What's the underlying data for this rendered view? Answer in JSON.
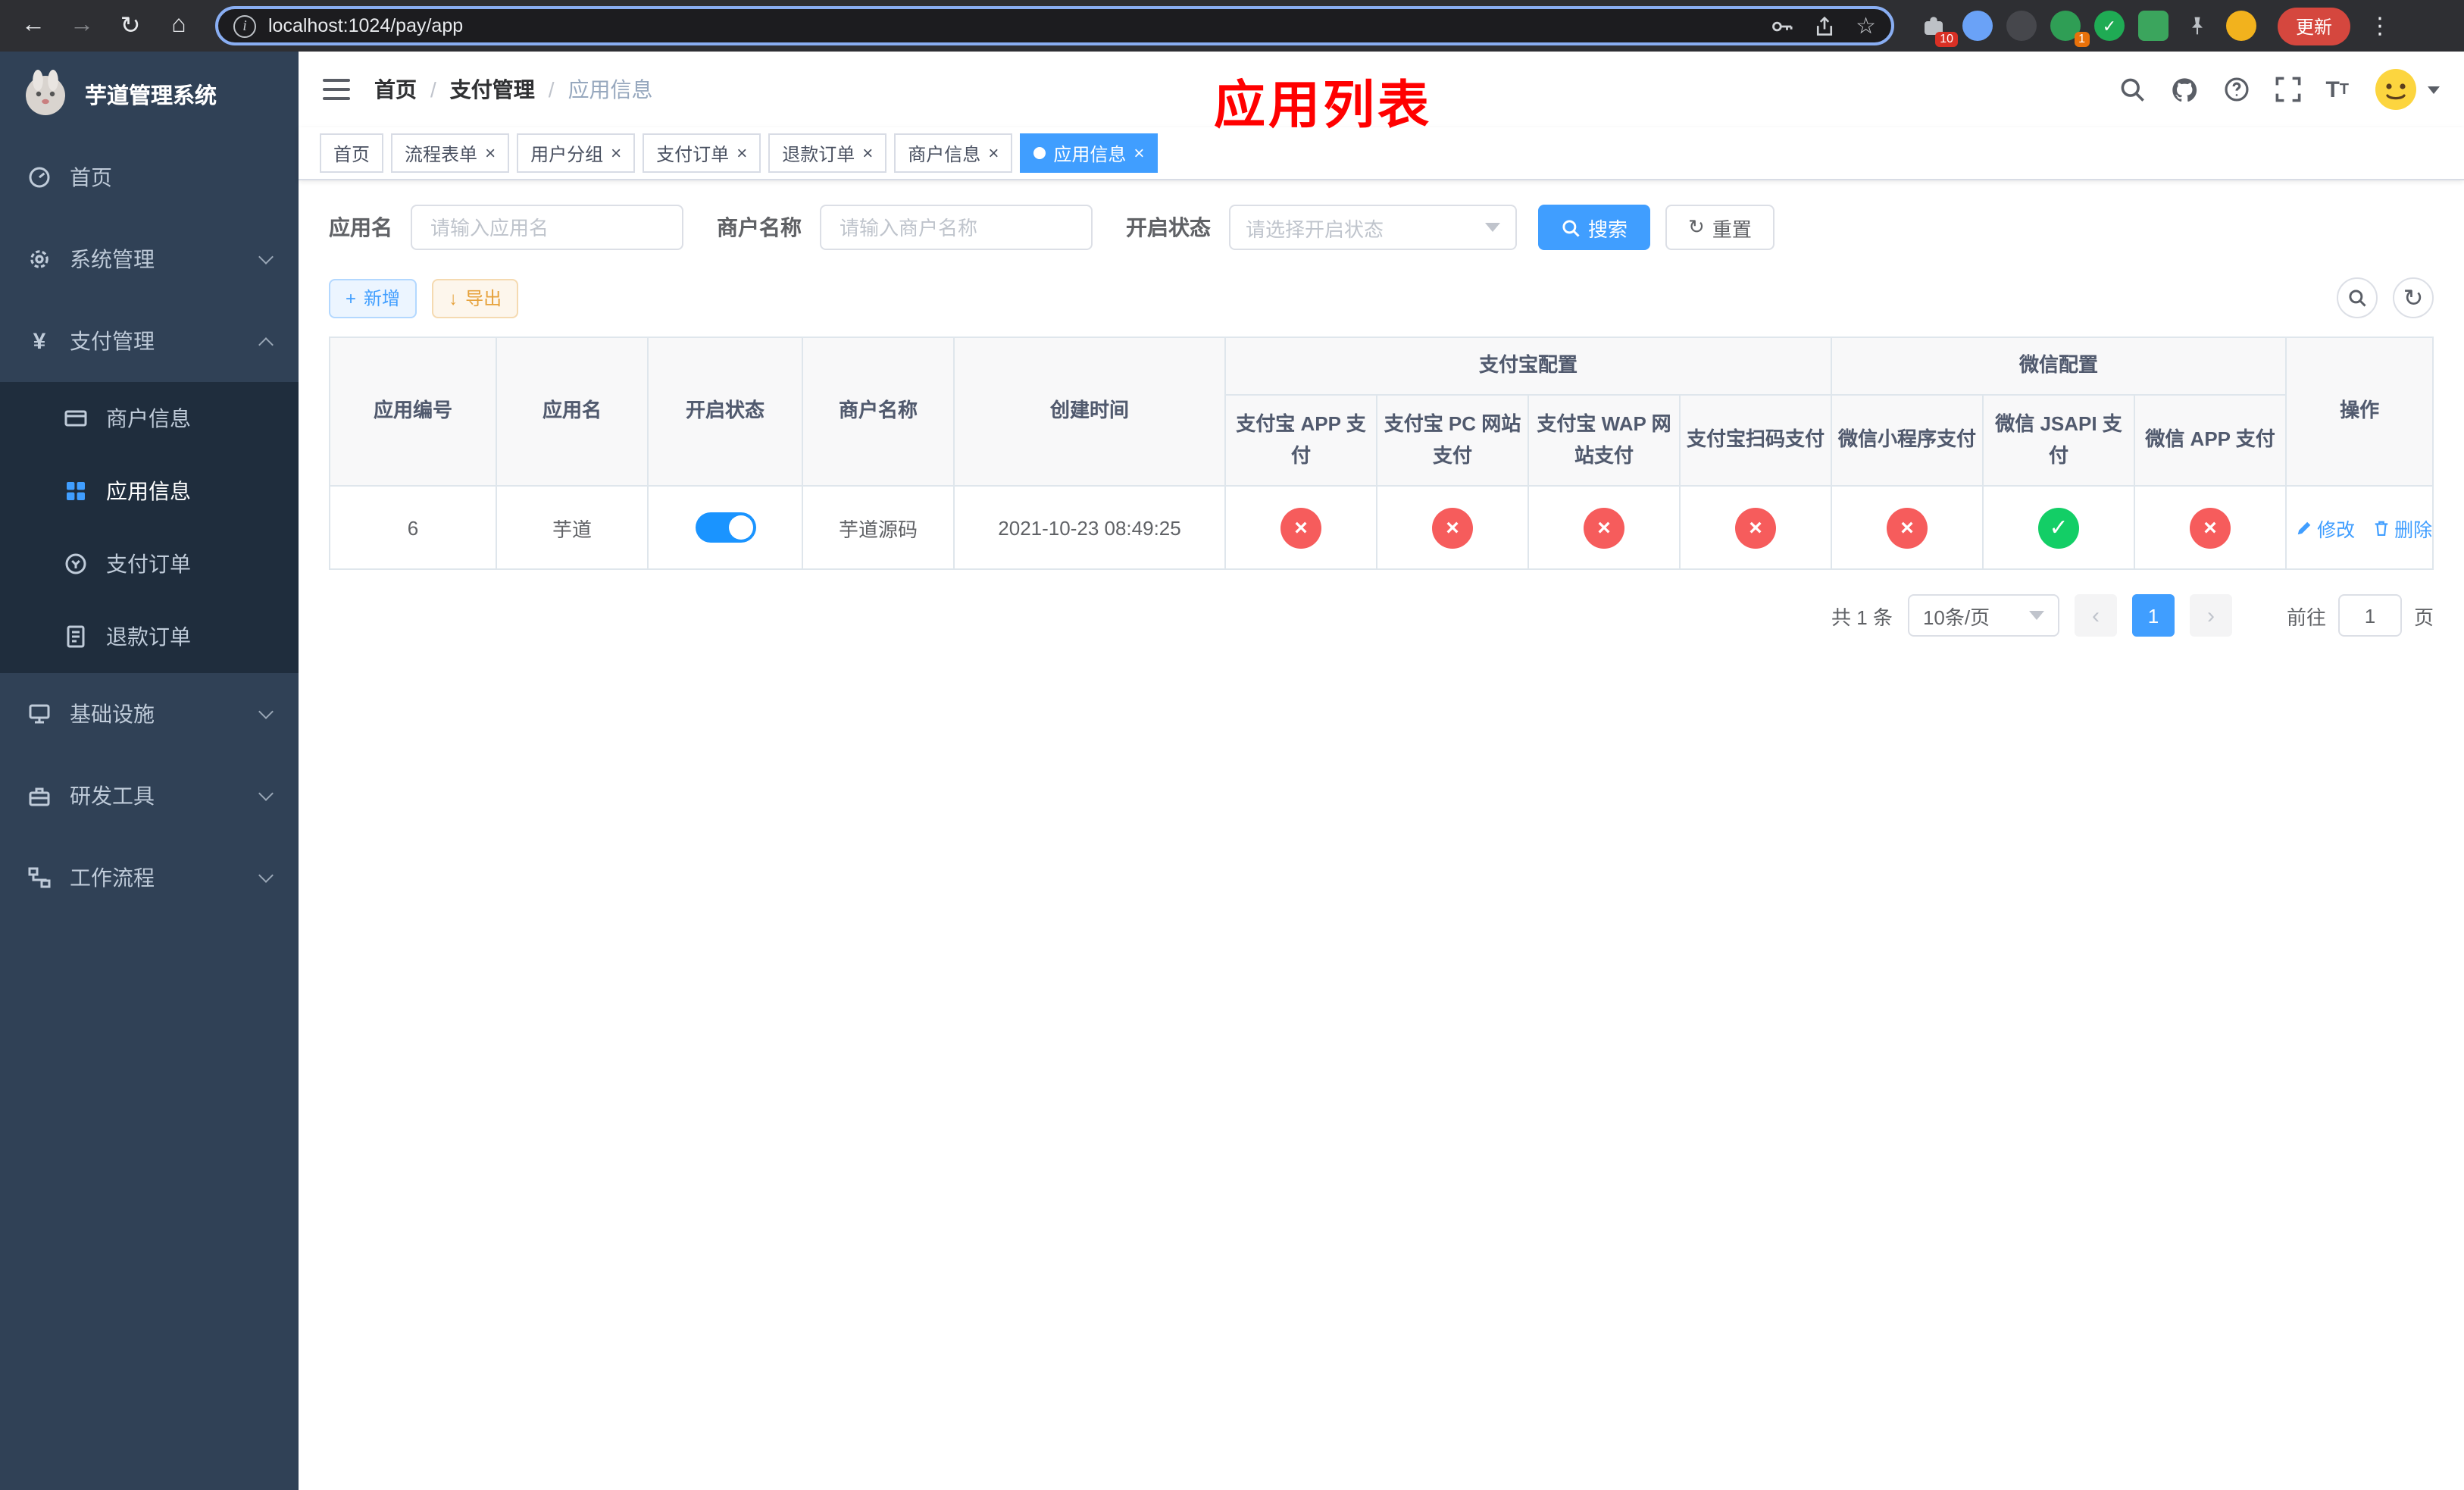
{
  "browser": {
    "url": "localhost:1024/pay/app",
    "update_button": "更新",
    "extension_badge": "10",
    "avatar_extension_badge": "1"
  },
  "icons": {
    "back": "←",
    "forward": "→",
    "reload": "↻",
    "home": "⌂",
    "info": "i",
    "star": "☆",
    "more": "⋮",
    "close": "×",
    "check": "✓",
    "plus": "+",
    "download": "↓",
    "refresh": "↻",
    "prev": "‹",
    "next": "›"
  },
  "colors": {
    "primary": "#409eff",
    "success": "#13ce66",
    "danger": "#f65c5c",
    "warning": "#e6a23c",
    "sidebar_bg": "#304156",
    "sidebar_sub_bg": "#1f2d3d",
    "overlay_title_red": "#ff0000",
    "update_chip_red": "#d5473e"
  },
  "sidebar": {
    "logo_title": "芋道管理系统",
    "items": [
      {
        "label": "首页"
      },
      {
        "label": "系统管理"
      },
      {
        "label": "支付管理",
        "children": [
          {
            "label": "商户信息"
          },
          {
            "label": "应用信息",
            "active": true
          },
          {
            "label": "支付订单"
          },
          {
            "label": "退款订单"
          }
        ]
      },
      {
        "label": "基础设施"
      },
      {
        "label": "研发工具"
      },
      {
        "label": "工作流程"
      }
    ]
  },
  "header": {
    "breadcrumb": [
      "首页",
      "支付管理",
      "应用信息"
    ],
    "overlay_title": "应用列表"
  },
  "tabs": [
    {
      "label": "首页"
    },
    {
      "label": "流程表单"
    },
    {
      "label": "用户分组"
    },
    {
      "label": "支付订单"
    },
    {
      "label": "退款订单"
    },
    {
      "label": "商户信息"
    },
    {
      "label": "应用信息",
      "active": true
    }
  ],
  "filters": {
    "app_name_label": "应用名",
    "app_name_placeholder": "请输入应用名",
    "merchant_label": "商户名称",
    "merchant_placeholder": "请输入商户名称",
    "status_label": "开启状态",
    "status_placeholder": "请选择开启状态",
    "search_button": "搜索",
    "reset_button": "重置"
  },
  "toolbar": {
    "add_button": "新增",
    "export_button": "导出"
  },
  "table": {
    "headers": {
      "app_id": "应用编号",
      "app_name": "应用名",
      "status": "开启状态",
      "merchant": "商户名称",
      "create_time": "创建时间",
      "alipay_group": "支付宝配置",
      "wechat_group": "微信配置",
      "actions": "操作",
      "alipay_cols": [
        "支付宝 APP 支付",
        "支付宝 PC 网站支付",
        "支付宝 WAP 网站支付",
        "支付宝扫码支付"
      ],
      "wechat_cols": [
        "微信小程序支付",
        "微信 JSAPI 支付",
        "微信 APP 支付"
      ]
    },
    "rows": [
      {
        "app_id": "6",
        "app_name": "芋道",
        "status_on": true,
        "merchant": "芋道源码",
        "create_time": "2021-10-23 08:49:25",
        "configs": [
          "no",
          "no",
          "no",
          "no",
          "no",
          "yes",
          "no"
        ],
        "edit_label": "修改",
        "delete_label": "删除"
      }
    ]
  },
  "pagination": {
    "total_text": "共 1 条",
    "page_size": "10条/页",
    "current_page": "1",
    "goto_label": "前往",
    "goto_value": "1",
    "page_unit": "页"
  }
}
